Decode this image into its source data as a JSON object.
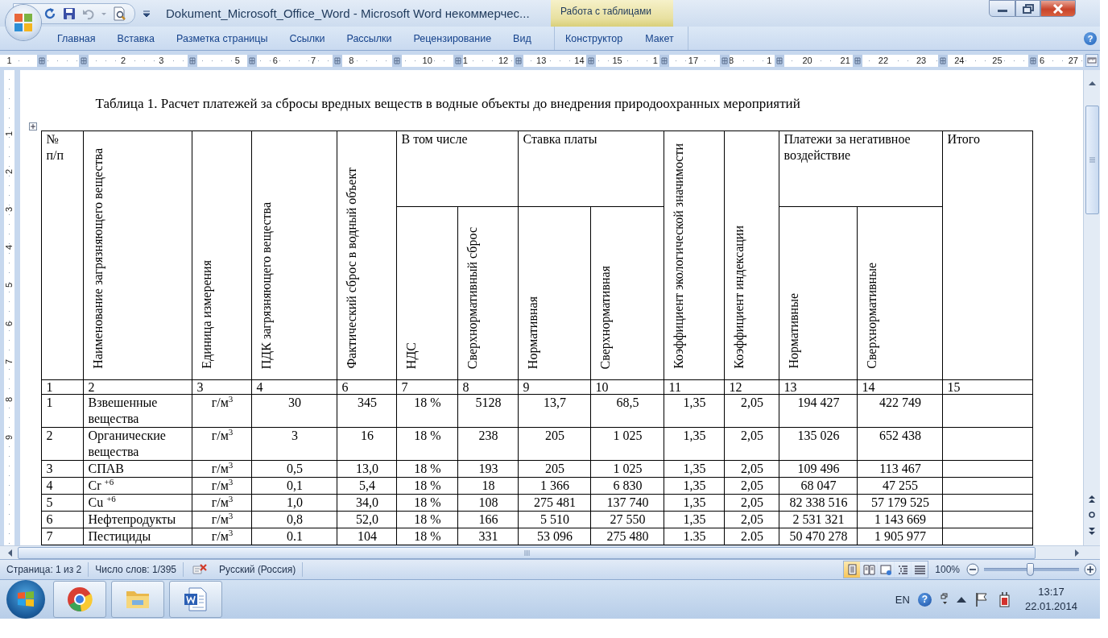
{
  "window": {
    "title": "Dokument_Microsoft_Office_Word - Microsoft Word некоммерчес...",
    "context_tab": "Работа с таблицами",
    "help": "?"
  },
  "ribbon_tabs": [
    {
      "label": "Главная",
      "selected": false
    },
    {
      "label": "Вставка",
      "selected": false
    },
    {
      "label": "Разметка страницы",
      "selected": false
    },
    {
      "label": "Ссылки",
      "selected": false
    },
    {
      "label": "Рассылки",
      "selected": false
    },
    {
      "label": "Рецензирование",
      "selected": false
    },
    {
      "label": "Вид",
      "selected": false
    }
  ],
  "table_tools_tabs": [
    {
      "label": "Конструктор",
      "selected": false
    },
    {
      "label": "Макет",
      "selected": false
    }
  ],
  "ruler": {
    "slots": [
      {
        "kind": "number",
        "text": "1"
      },
      {
        "kind": "blank"
      },
      {
        "kind": "blank"
      },
      {
        "kind": "number",
        "text": "2"
      },
      {
        "kind": "number",
        "text": "3"
      },
      {
        "kind": "blank"
      },
      {
        "kind": "number",
        "text": "5"
      },
      {
        "kind": "number",
        "text": "6"
      },
      {
        "kind": "number",
        "text": "7"
      },
      {
        "kind": "number",
        "text": "8"
      },
      {
        "kind": "blank"
      },
      {
        "kind": "number",
        "text": "10"
      },
      {
        "kind": "number",
        "text": "1"
      },
      {
        "kind": "number",
        "text": "12"
      },
      {
        "kind": "number",
        "text": "13"
      },
      {
        "kind": "number",
        "text": "14"
      },
      {
        "kind": "number",
        "text": "15"
      },
      {
        "kind": "number",
        "text": "1"
      },
      {
        "kind": "number",
        "text": "17"
      },
      {
        "kind": "number",
        "text": "8"
      },
      {
        "kind": "number",
        "text": "1"
      },
      {
        "kind": "number",
        "text": "20"
      },
      {
        "kind": "number",
        "text": "21"
      },
      {
        "kind": "number",
        "text": "22"
      },
      {
        "kind": "number",
        "text": "23"
      },
      {
        "kind": "number",
        "text": "24"
      },
      {
        "kind": "number",
        "text": "25"
      },
      {
        "kind": "partial",
        "text": "6"
      },
      {
        "kind": "number",
        "text": "27"
      }
    ]
  },
  "vertical_ruler": {
    "labels": [
      "1",
      "2",
      "3",
      "4",
      "5",
      "6",
      "7",
      "8",
      "9"
    ]
  },
  "document": {
    "caption": "Таблица 1. Расчет платежей за сбросы вредных веществ в водные объекты до внедрения природоохранных мероприятий",
    "table": {
      "header": [
        {
          "kind": "plain",
          "text": "№ п/п"
        },
        {
          "kind": "vertical",
          "text": "Наименование загрязняющего вещества"
        },
        {
          "kind": "vertical",
          "text": "Единица измерения"
        },
        {
          "kind": "vertical",
          "text": "ПДК загрязняющего вещества"
        },
        {
          "kind": "vertical",
          "text": "Фактический сброс в водный объект"
        },
        {
          "kind": "group",
          "text": "В том числе",
          "children": [
            "НДС",
            "Сверхнормативный сброс"
          ]
        },
        {
          "kind": "group",
          "text": "Ставка платы",
          "children": [
            "Нормативная",
            "Сверхнормативная"
          ]
        },
        {
          "kind": "vertical",
          "text": "Коэффициент экологической значимости"
        },
        {
          "kind": "vertical",
          "text": "Коэффициент индексации"
        },
        {
          "kind": "group",
          "text": "Платежи за негативное воздействие",
          "children": [
            "Нормативные",
            "Сверхнормативные"
          ]
        },
        {
          "kind": "plain",
          "text": "Итого"
        }
      ],
      "number_row": [
        "1",
        "2",
        "3",
        "4",
        "6",
        "7",
        "8",
        "9",
        "10",
        "11",
        "12",
        "13",
        "14",
        "15"
      ],
      "rows": [
        [
          "1",
          "Взвешенные вещества",
          "г/м$^{3}$",
          "30",
          "345",
          "18 %",
          "5128",
          "13,7",
          "68,5",
          "1,35",
          "2,05",
          "194 427",
          "422 749"
        ],
        [
          "2",
          "Органические вещества",
          "г/м$^{3}$",
          "3",
          "16",
          "18 %",
          "238",
          "205",
          "1 025",
          "1,35",
          "2,05",
          "135 026",
          "652 438"
        ],
        [
          "3",
          "СПАВ",
          "г/м$^{3}$",
          "0,5",
          "13,0",
          "18 %",
          "193",
          "205",
          "1 025",
          "1,35",
          "2,05",
          "109 496",
          "113 467"
        ],
        [
          "4",
          "Cr $^{+6}$",
          "г/м$^{3}$",
          "0,1",
          "5,4",
          "18 %",
          "18",
          "1 366",
          "6 830",
          "1,35",
          "2,05",
          "68 047",
          "47 255"
        ],
        [
          "5",
          "Cu $^{+6}$",
          "г/м$^{3}$",
          "1,0",
          "34,0",
          "18 %",
          "108",
          "275 481",
          "137 740",
          "1,35",
          "2,05",
          "82 338 516",
          "57 179 525"
        ],
        [
          "6",
          "Нефтепродукты",
          "г/м$^{3}$",
          "0,8",
          "52,0",
          "18 %",
          "166",
          "5 510",
          "27 550",
          "1,35",
          "2,05",
          "2 531 321",
          "1 143 669"
        ],
        [
          "7",
          "Пестициды",
          "г/м$^{3}$",
          "0.1",
          "104",
          "18 %",
          "331",
          "53 096",
          "275 480",
          "1.35",
          "2.05",
          "50 470 278",
          "1 905 977"
        ]
      ]
    }
  },
  "status_bar": {
    "page": "Страница: 1 из 2",
    "words": "Число слов: 1/395",
    "language": "Русский (Россия)",
    "views": [
      {
        "kind": "print",
        "selected": true
      },
      {
        "kind": "reading",
        "selected": false
      },
      {
        "kind": "web",
        "selected": false
      },
      {
        "kind": "outline",
        "selected": false
      },
      {
        "kind": "draft",
        "selected": false
      }
    ],
    "zoom": "100%",
    "zoom_slider": {
      "level": 0.48
    }
  },
  "taskbar": {
    "apps": [
      {
        "kind": "browser"
      },
      {
        "kind": "folder"
      },
      {
        "kind": "word"
      }
    ],
    "language": "EN",
    "help": "?",
    "time": "13:17",
    "date": "22.01.2014"
  }
}
